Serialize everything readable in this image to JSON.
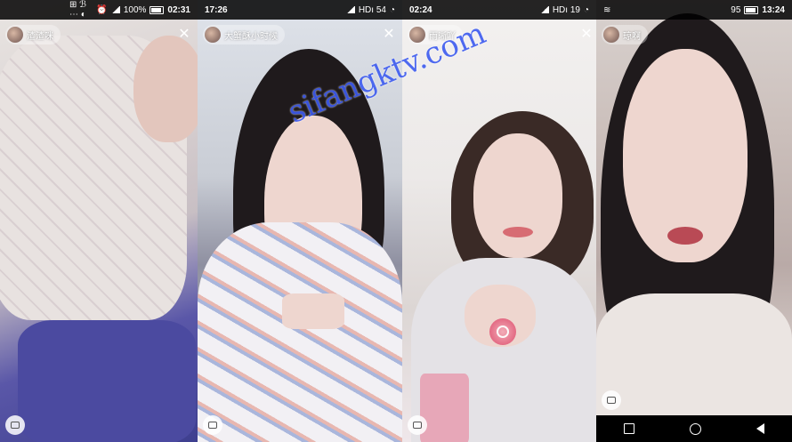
{
  "panels": [
    {
      "status": {
        "time": "02:31",
        "battery": "100%",
        "left_icons": "⊞ ℬ ⋯ ◐"
      },
      "user": {
        "name": "渣渣咪"
      },
      "close_icon": "close-icon"
    },
    {
      "status": {
        "time": "17:26",
        "net": "HDı 54"
      },
      "user": {
        "name": "大蟹酥小时候"
      },
      "close_icon": "close-icon"
    },
    {
      "status": {
        "time": "02:24",
        "net": "HDı 19"
      },
      "user": {
        "name": "雨晰吖"
      },
      "close_icon": "close-icon"
    },
    {
      "status": {
        "time": "13:24",
        "battery": "95"
      },
      "user": {
        "name": "琼啊"
      },
      "close_icon": "close-icon"
    }
  ],
  "watermark": "sifangktv.com"
}
